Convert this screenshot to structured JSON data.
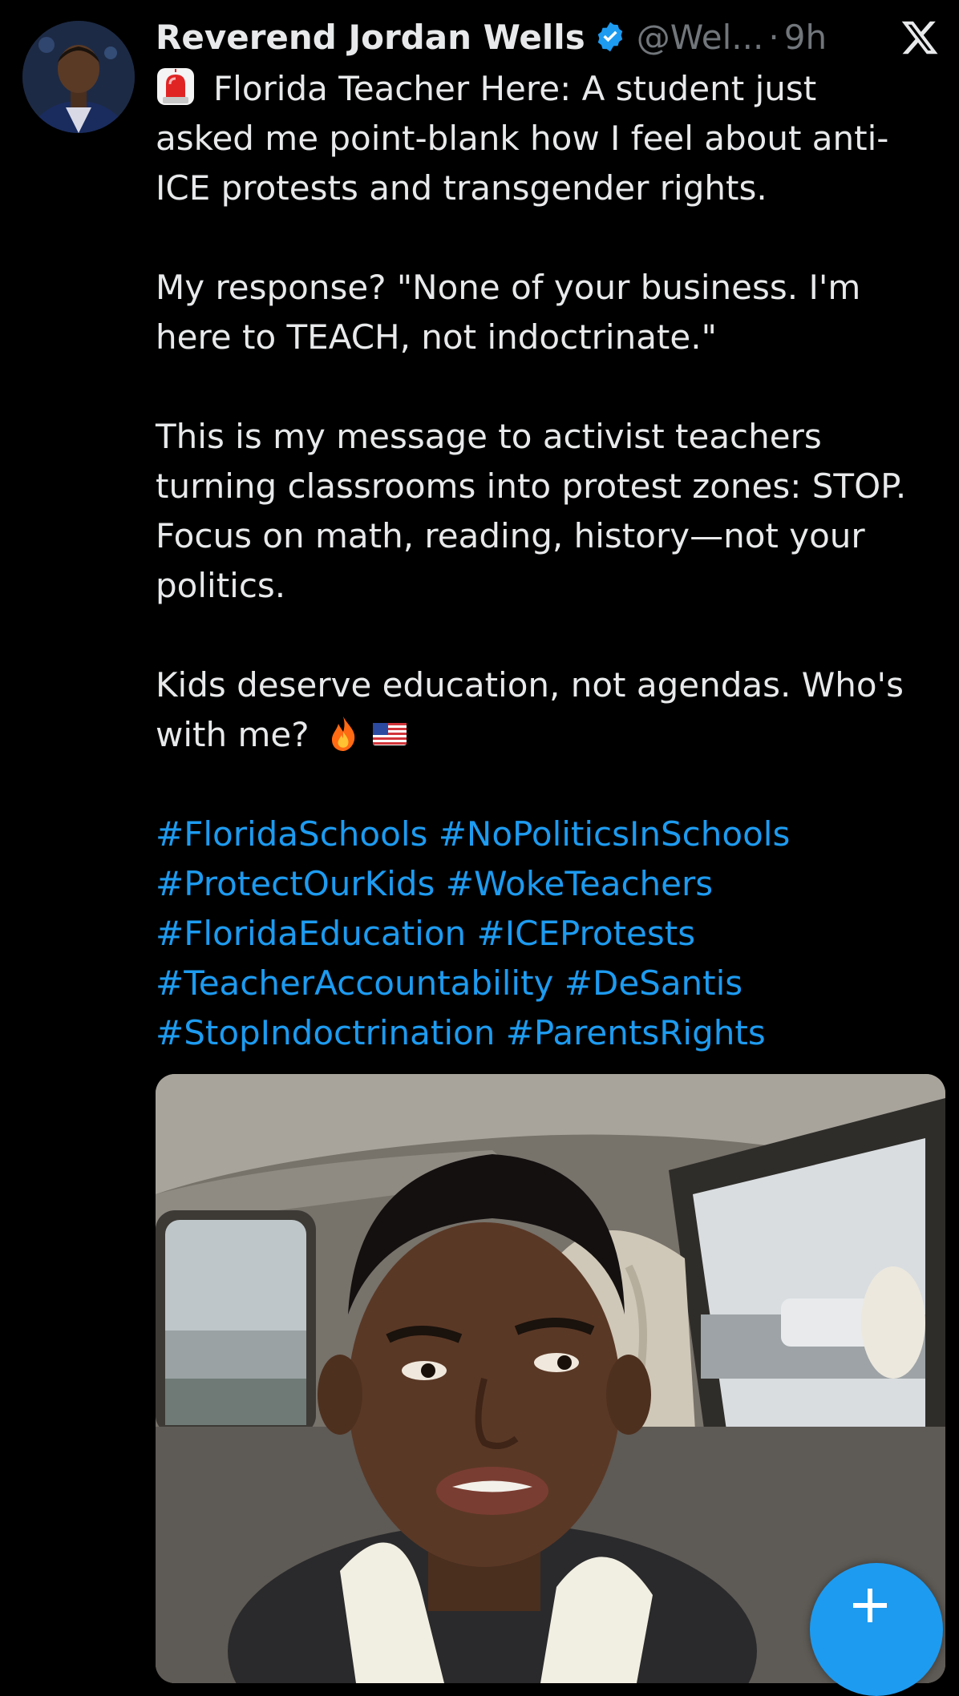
{
  "post": {
    "author": {
      "display_name": "Reverend Jordan Wells",
      "handle": "@Wel...",
      "verified": true
    },
    "separator": "·",
    "time": "9h",
    "paragraphs": [
      [
        "Florida Teacher Here: A student just",
        "asked me point-blank how I feel about anti-",
        "ICE protests and transgender rights."
      ],
      [
        "My response? \"None of your business. I'm",
        "here to TEACH, not indoctrinate.\""
      ],
      [
        "This is my message to activist teachers",
        "turning classrooms into protest zones: STOP.",
        "Focus on math, reading, history—not your",
        "politics."
      ],
      [
        "Kids deserve education, not agendas. Who's",
        "with me?"
      ]
    ],
    "hashtag_lines": [
      [
        "#FloridaSchools",
        "#NoPoliticsInSchools"
      ],
      [
        "#ProtectOurKids",
        "#WokeTeachers"
      ],
      [
        "#FloridaEducation",
        "#ICEProtests"
      ],
      [
        "#TeacherAccountability",
        "#DeSantis"
      ],
      [
        "#StopIndoctrination",
        "#ParentsRights"
      ]
    ]
  },
  "icons": {
    "avatar": "profile-photo",
    "verified": "verified-badge-icon",
    "close": "x-logo-icon",
    "siren": "rotating-light-emoji",
    "fire": "fire-emoji",
    "flag": "us-flag-emoji",
    "compose": "plus-icon"
  },
  "colors": {
    "background": "#000000",
    "text": "#e7e9ea",
    "muted": "#71767b",
    "accent": "#1d9bf0"
  }
}
